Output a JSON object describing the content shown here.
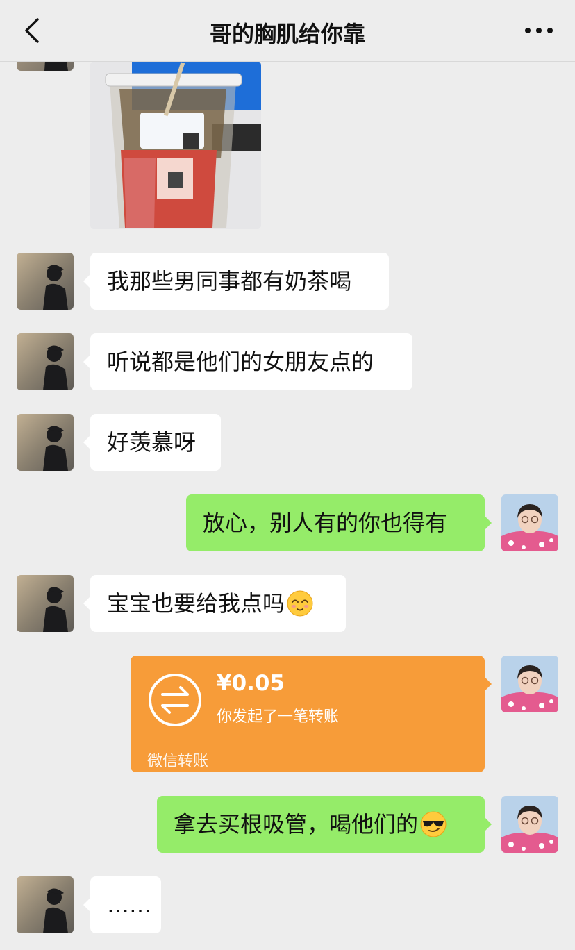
{
  "header": {
    "title": "哥的胸肌给你靠",
    "back_icon": "chevron-left-icon",
    "more_icon": "more-dots-icon"
  },
  "messages": [
    {
      "side": "left",
      "type": "image",
      "alt_icon": "milk-tea-photo"
    },
    {
      "side": "left",
      "type": "text",
      "text": "我那些男同事都有奶茶喝"
    },
    {
      "side": "left",
      "type": "text",
      "text": "听说都是他们的女朋友点的"
    },
    {
      "side": "left",
      "type": "text",
      "text": "好羡慕呀"
    },
    {
      "side": "right",
      "type": "text",
      "text": "放心，别人有的你也得有"
    },
    {
      "side": "left",
      "type": "text",
      "text": "宝宝也要给我点吗",
      "emoji": "pleading-face-icon"
    },
    {
      "side": "right",
      "type": "transfer",
      "amount": "¥0.05",
      "note": "你发起了一笔转账",
      "source": "微信转账"
    },
    {
      "side": "right",
      "type": "text",
      "text": "拿去买根吸管，喝他们的",
      "emoji": "sunglasses-face-icon"
    },
    {
      "side": "left",
      "type": "text",
      "text": "……"
    }
  ],
  "colors": {
    "background": "#ededed",
    "sent_bubble": "#95ec69",
    "received_bubble": "#ffffff",
    "transfer": "#f79c39"
  }
}
